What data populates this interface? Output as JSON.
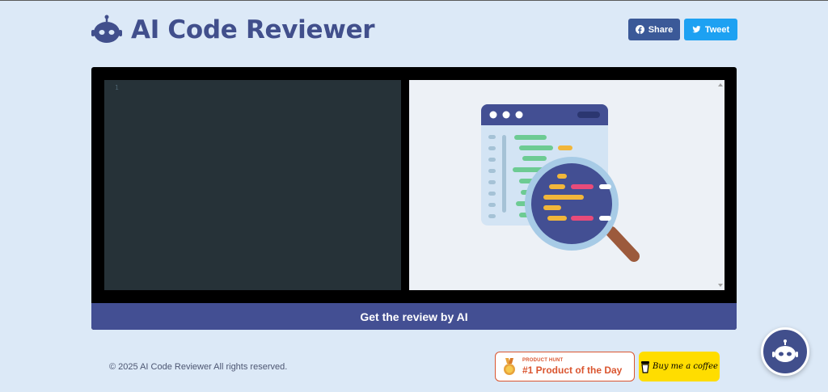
{
  "header": {
    "title": "AI Code Reviewer",
    "logo_icon": "robot-icon"
  },
  "share": {
    "share_label": "Share",
    "tweet_label": "Tweet",
    "share_icon": "facebook-icon",
    "tweet_icon": "twitter-icon"
  },
  "editor": {
    "line_number": "1",
    "content": ""
  },
  "preview": {
    "illustration": "code-magnifier-illustration"
  },
  "review_button": {
    "label": "Get the review by AI"
  },
  "footer": {
    "copyright": "© 2025 AI Code Reviewer All rights reserved.",
    "product_hunt": {
      "small": "PRODUCT HUNT",
      "big": "#1 Product of the Day"
    },
    "coffee": {
      "label": "Buy me a coffee"
    }
  },
  "chat_fab": {
    "icon": "robot-icon"
  },
  "colors": {
    "background": "#dce9f7",
    "primary": "#414f8c",
    "facebook": "#3b5998",
    "twitter": "#1da1f2",
    "producthunt": "#da552f",
    "coffee": "#ffdd00"
  }
}
